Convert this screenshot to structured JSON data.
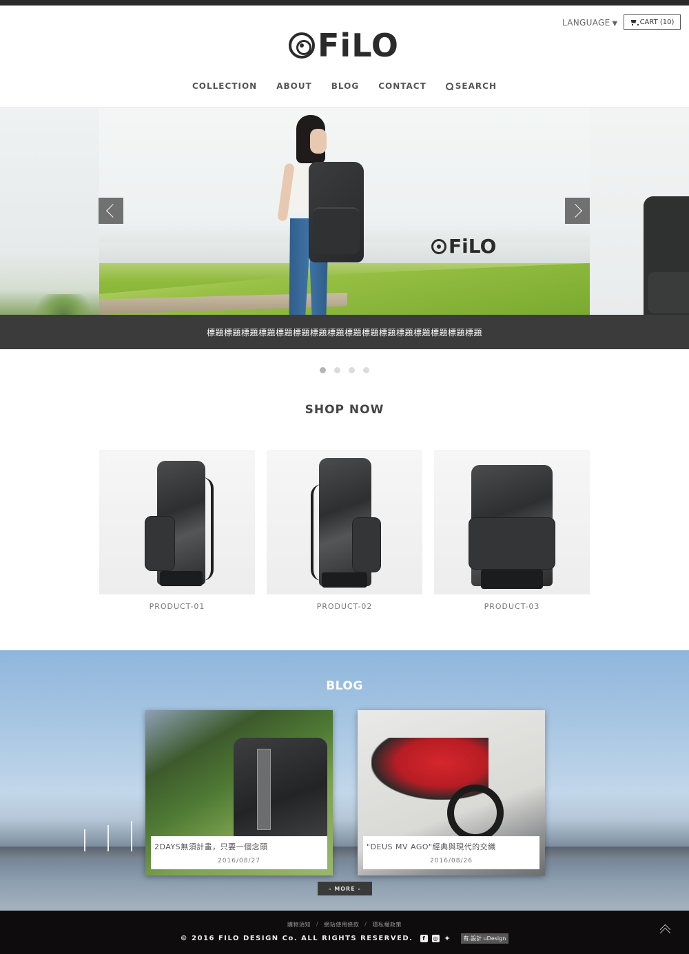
{
  "header": {
    "language_label": "LANGUAGE",
    "language_caret": "▼",
    "cart_label": "CART (10)",
    "logo_text": "FiLO"
  },
  "nav": {
    "items": [
      {
        "label": "COLLECTION"
      },
      {
        "label": "ABOUT"
      },
      {
        "label": "BLOG"
      },
      {
        "label": "CONTACT"
      }
    ],
    "search_label": "SEARCH"
  },
  "slider": {
    "slide_logo_text": "FiLO",
    "caption": "標題標題標題標題標題標題標題標題標題標題標題標題標題標題標題標題",
    "dots": 4,
    "active_dot": 1
  },
  "shop": {
    "title": "SHOP NOW",
    "products": [
      {
        "name": "PRODUCT-01"
      },
      {
        "name": "PRODUCT-02"
      },
      {
        "name": "PRODUCT-03"
      }
    ]
  },
  "blog": {
    "title": "BLOG",
    "posts": [
      {
        "title": "2DAYS無須計畫，只要一個念頭",
        "date": "2016/08/27"
      },
      {
        "title": "\"DEUS MV AGO\"經典與現代的交織",
        "date": "2016/08/26"
      }
    ],
    "more_label": "- MORE -"
  },
  "footer": {
    "links": [
      "購物須知",
      "網站使用條款",
      "隱私權政策"
    ],
    "separator": "/",
    "copyright": "© 2016 FILO DESIGN Co. ALL RIGHTS RESERVED.",
    "social": [
      "facebook-icon",
      "instagram-icon",
      "twitter-icon"
    ],
    "credit": "有.設計 uDesign"
  },
  "colors": {
    "dark": "#2b2b2b",
    "caption_bg": "#3b3b3b",
    "footer_bg": "#0e0c0d"
  }
}
